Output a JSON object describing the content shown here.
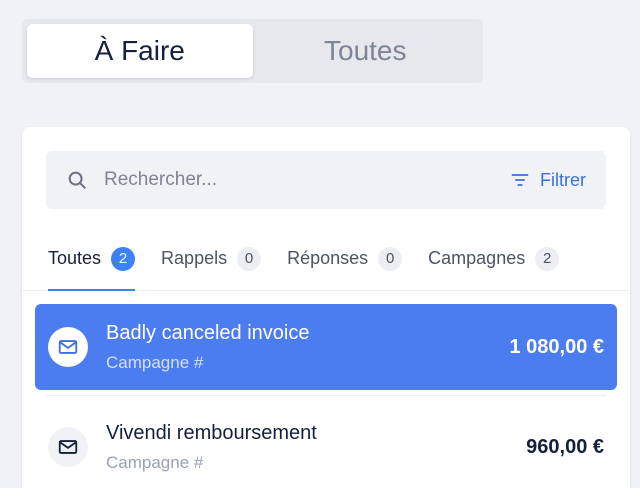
{
  "segmented": {
    "options": [
      {
        "label": "À Faire",
        "active": true
      },
      {
        "label": "Toutes",
        "active": false
      }
    ]
  },
  "search": {
    "placeholder": "Rechercher...",
    "value": ""
  },
  "filter": {
    "label": "Filtrer",
    "icon": "filter-lines-icon"
  },
  "tabs": [
    {
      "label": "Toutes",
      "count": "2",
      "active": true
    },
    {
      "label": "Rappels",
      "count": "0",
      "active": false
    },
    {
      "label": "Réponses",
      "count": "0",
      "active": false
    },
    {
      "label": "Campagnes",
      "count": "2",
      "active": false
    }
  ],
  "items": [
    {
      "title": "Badly canceled invoice",
      "subtitle": "Campagne #",
      "amount": "1 080,00 €",
      "icon": "envelope-icon",
      "selected": true
    },
    {
      "title": "Vivendi remboursement",
      "subtitle": "Campagne #",
      "amount": "960,00 €",
      "icon": "envelope-icon",
      "selected": false
    }
  ],
  "colors": {
    "accent": "#3b82f6",
    "selected_row": "#4b7cf0",
    "background": "#f1f2f6",
    "text_dark": "#14213d",
    "text_muted": "#7d8497"
  }
}
